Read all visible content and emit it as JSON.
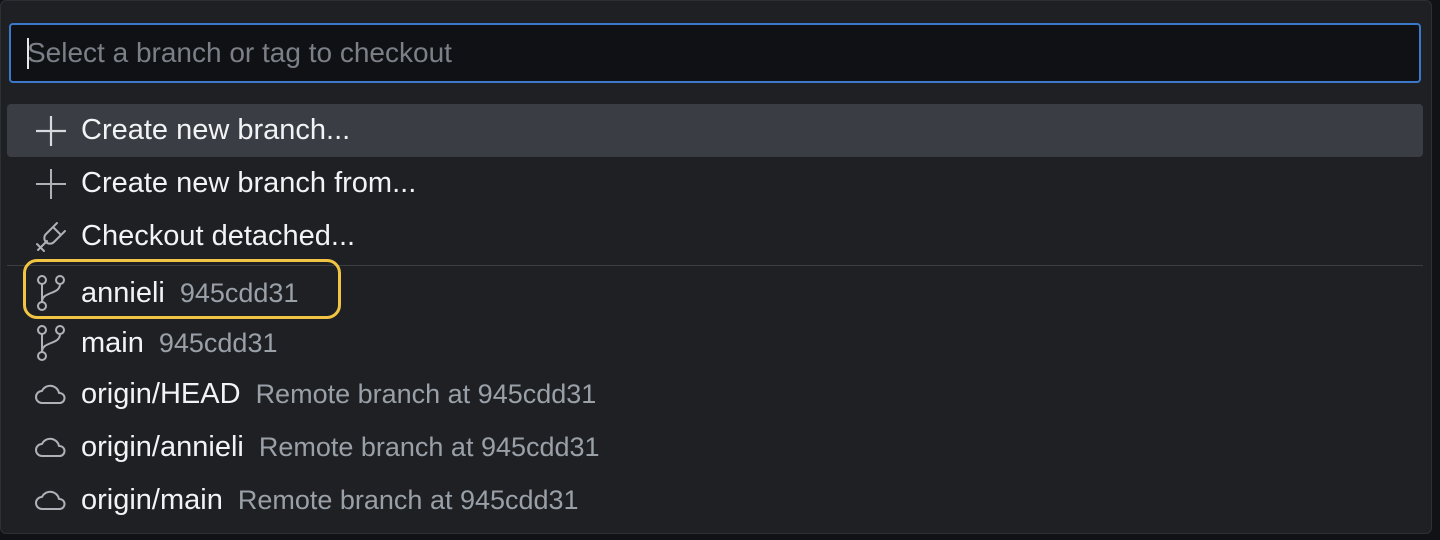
{
  "search": {
    "placeholder": "Select a branch or tag to checkout",
    "value": ""
  },
  "actions": [
    {
      "icon": "plus-icon",
      "label": "Create new branch...",
      "active": true
    },
    {
      "icon": "plus-icon",
      "label": "Create new branch from...",
      "active": false
    },
    {
      "icon": "detached-plug-icon",
      "label": "Checkout detached...",
      "active": false
    }
  ],
  "refs": [
    {
      "icon": "git-branch-icon",
      "label": "annieli",
      "desc": "945cdd31",
      "highlighted": true
    },
    {
      "icon": "git-branch-icon",
      "label": "main",
      "desc": "945cdd31"
    },
    {
      "icon": "cloud-icon",
      "label": "origin/HEAD",
      "desc": "Remote branch at 945cdd31"
    },
    {
      "icon": "cloud-icon",
      "label": "origin/annieli",
      "desc": "Remote branch at 945cdd31"
    },
    {
      "icon": "cloud-icon",
      "label": "origin/main",
      "desc": "Remote branch at 945cdd31"
    }
  ],
  "colors": {
    "focus_border": "#3b78c9",
    "highlight_annotation": "#f2c443",
    "active_row": "#3a3d44"
  }
}
